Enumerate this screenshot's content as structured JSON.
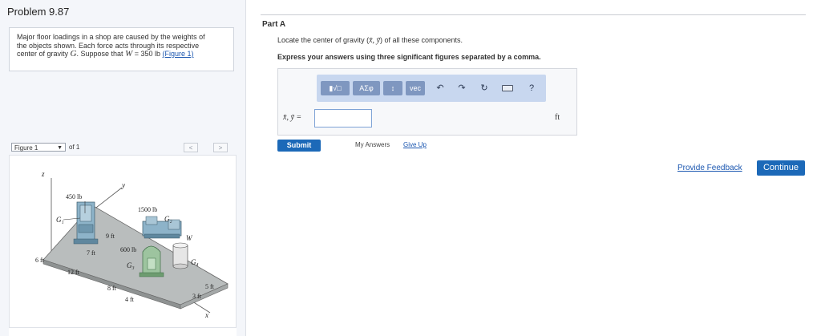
{
  "problem": {
    "title": "Problem 9.87",
    "text_line1": "Major floor loadings in a shop are caused by the weights of",
    "text_line2": "the objects shown. Each force acts through its respective",
    "text_line3_prefix": "center of gravity",
    "text_line3_var": "G",
    "text_line3_mid": ". Suppose that",
    "text_line3_W": "W",
    "text_line3_value": "= 350  lb",
    "figure_link": "(Figure 1)"
  },
  "figure": {
    "select_value": "Figure 1",
    "of_text": "of 1",
    "prev_label": "<",
    "next_label": ">",
    "labels": {
      "z": "z",
      "y": "y",
      "x": "x",
      "W": "W",
      "G1": "G₁",
      "G2": "G₂",
      "G3": "G₃",
      "G4": "G₄",
      "f450": "450 lb",
      "f1500": "1500 lb",
      "f600": "600 lb",
      "d9": "9 ft",
      "d7": "7 ft",
      "d6": "6 ft",
      "d12": "12 ft",
      "d8": "8 ft",
      "d4": "4 ft",
      "d5": "5 ft",
      "d3": "3 ft"
    }
  },
  "part": {
    "label": "Part A",
    "instruction_prefix": "Locate the center of gravity (",
    "instruction_math": "x̄, ȳ",
    "instruction_suffix": ") of all these components.",
    "express": "Express your answers using three significant figures separated by a comma.",
    "toolbar": {
      "templates": "▮√□",
      "greek": "AΣφ",
      "updown": "↕",
      "vec": "vec",
      "undo": "↶",
      "redo": "↷",
      "reset": "↻",
      "help": "?"
    },
    "input_label": "x̄, ȳ =",
    "input_value": "",
    "unit": "ft",
    "submit_label": "Submit",
    "my_answers_label": "My Answers",
    "give_up_label": "Give Up"
  },
  "footer": {
    "feedback_label": "Provide Feedback",
    "continue_label": "Continue"
  }
}
